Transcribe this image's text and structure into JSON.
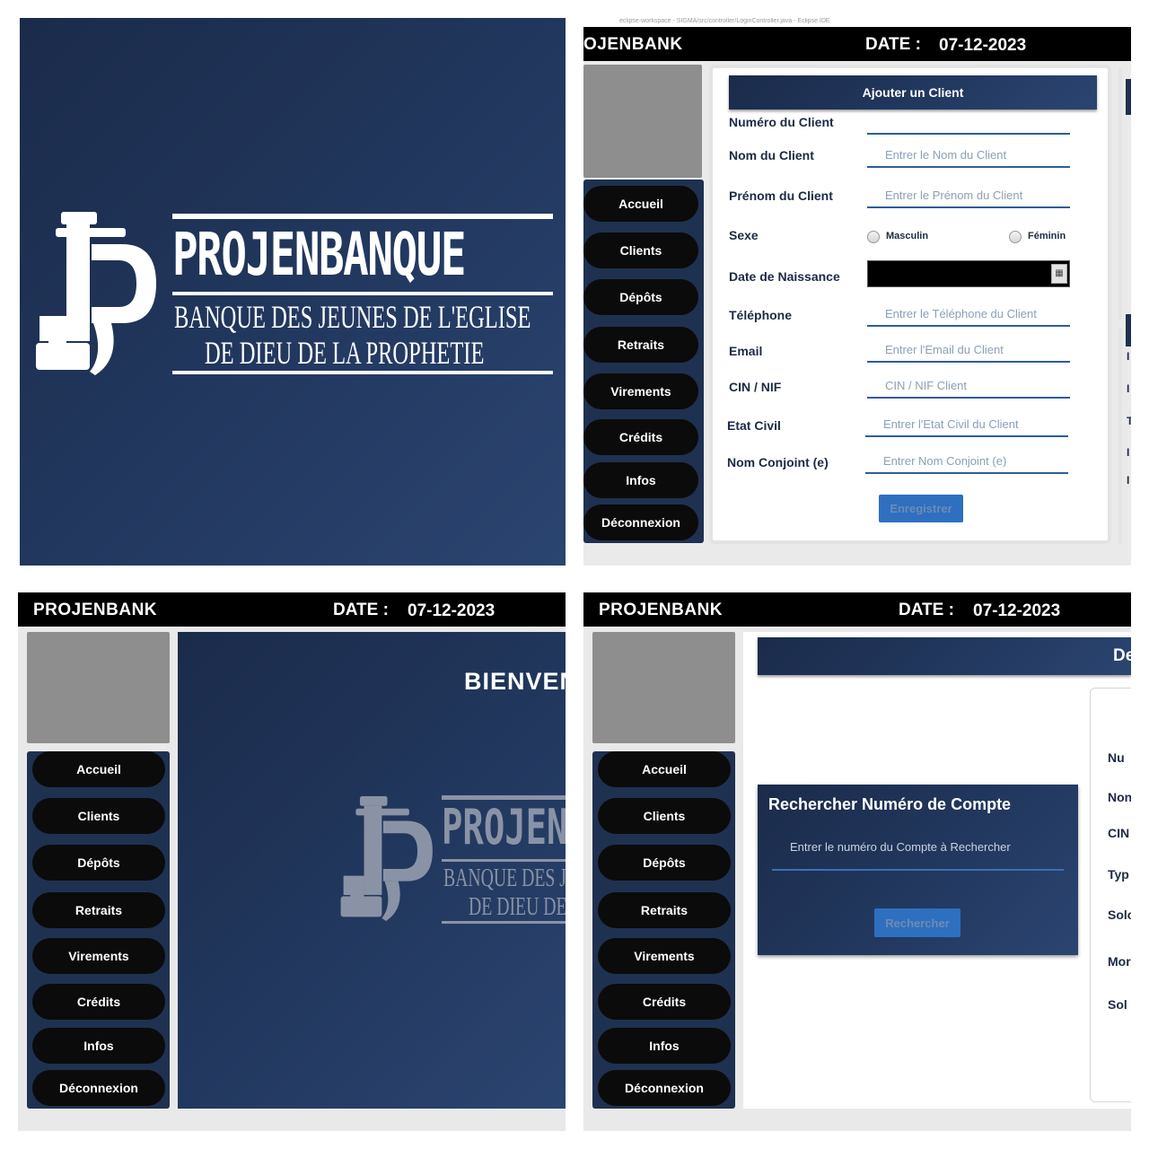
{
  "splash": {
    "logo_title": "PROJENBANQUE",
    "logo_line1": "BANQUE DES JEUNES DE L'EGLISE",
    "logo_line2": "DE DIEU DE LA PROPHETIE"
  },
  "header": {
    "brand_full": "PROJENBANK",
    "brand_cropped": "OJENBANK",
    "date_label": "DATE :",
    "date_value": "07-12-2023"
  },
  "window_caption": "eclipse-workspace - SIGMA/src/controller/LoginController.java - Eclipse IDE",
  "sidebar": {
    "items": [
      {
        "label": "Accueil"
      },
      {
        "label": "Clients"
      },
      {
        "label": "Dépôts"
      },
      {
        "label": "Retraits"
      },
      {
        "label": "Virements"
      },
      {
        "label": "Crédits"
      },
      {
        "label": "Infos"
      },
      {
        "label": "Déconnexion"
      }
    ]
  },
  "client_form": {
    "title": "Ajouter un Client",
    "labels": {
      "numero": "Numéro du Client",
      "nom": "Nom du Client",
      "prenom": "Prénom du Client",
      "sexe": "Sexe",
      "naissance": "Date de Naissance",
      "telephone": "Téléphone",
      "email": "Email",
      "cin": "CIN / NIF",
      "etat_civil": "Etat Civil",
      "conjoint": "Nom Conjoint (e)"
    },
    "placeholders": {
      "numero": "",
      "nom": "Entrer le Nom du Client",
      "prenom": "Entrer le Prénom du Client",
      "telephone": "Entrer le Téléphone du Client",
      "email": "Entrer l'Email du Client",
      "cin": "CIN / NIF Client",
      "etat_civil": "Entrer l'Etat Civil du Client",
      "conjoint": "Entrer Nom Conjoint (e)"
    },
    "sexe_options": [
      "Masculin",
      "Féminin"
    ],
    "submit": "Enregistrer",
    "right_cropped_letters": [
      "I",
      "I",
      "T",
      "I",
      "I"
    ]
  },
  "home": {
    "welcome_cropped": "BIENVEN",
    "logo_title_cropped": "PROJEN",
    "logo_line1_cropped": "BANQUE DES J",
    "logo_line2_cropped": "DE DIEU DE"
  },
  "search": {
    "banner_cropped": "De",
    "title": "Rechercher Numéro de Compte",
    "placeholder": "Entrer le numéro du Compte à Rechercher",
    "button": "Rechercher",
    "right_labels": [
      "Nu",
      "Non",
      "CIN",
      "Typ",
      "Solo",
      "Mor",
      "Sol"
    ]
  },
  "colors": {
    "navy": "#1f3150",
    "header": "#000000",
    "button_blue": "#2e6fc0",
    "input_underline": "#2d5d9b"
  }
}
